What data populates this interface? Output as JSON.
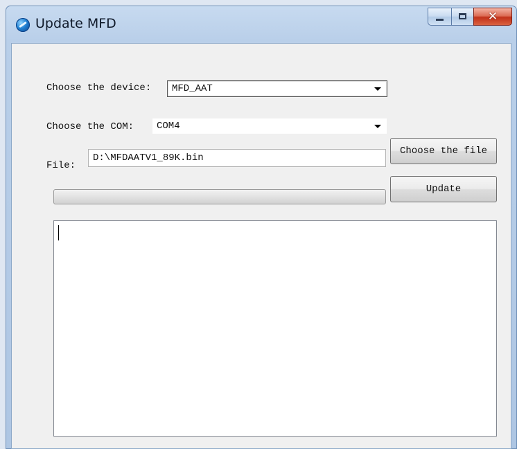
{
  "window": {
    "title": "Update MFD"
  },
  "form": {
    "device_label": "Choose the device:",
    "device_value": "MFD_AAT",
    "com_label": "Choose the COM:",
    "com_value": "COM4",
    "file_label": "File:",
    "file_value": "D:\\MFDAATV1_89K.bin",
    "choose_file_button": "Choose the file",
    "update_button": "Update",
    "progress_fraction": 0
  },
  "log": {
    "text": ""
  },
  "icons": {
    "app": "app-globe-icon",
    "minimize": "minimize-icon",
    "maximize": "maximize-icon",
    "close": "close-icon",
    "dropdown": "chevron-down-icon"
  }
}
